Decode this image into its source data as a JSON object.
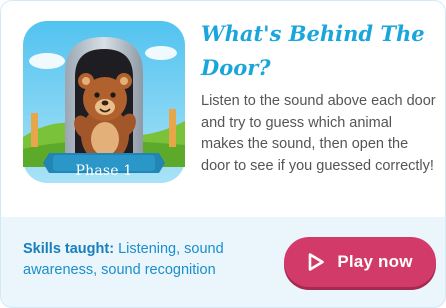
{
  "game": {
    "title": "What's Behind The Door?",
    "description": "Listen to the sound above each door and try to guess which animal makes the sound, then open the door to see if you guessed correctly!",
    "phase_label": "Phase 1",
    "skills_label": "Skills taught:",
    "skills_text": "Listening, sound awareness, sound recognition",
    "play_label": "Play now",
    "play_icon": "play-outline-icon"
  },
  "colors": {
    "title": "#1ba6db",
    "button": "#d23a6a",
    "card_bg": "#eaf5fc",
    "skills": "#1a8fcc"
  }
}
